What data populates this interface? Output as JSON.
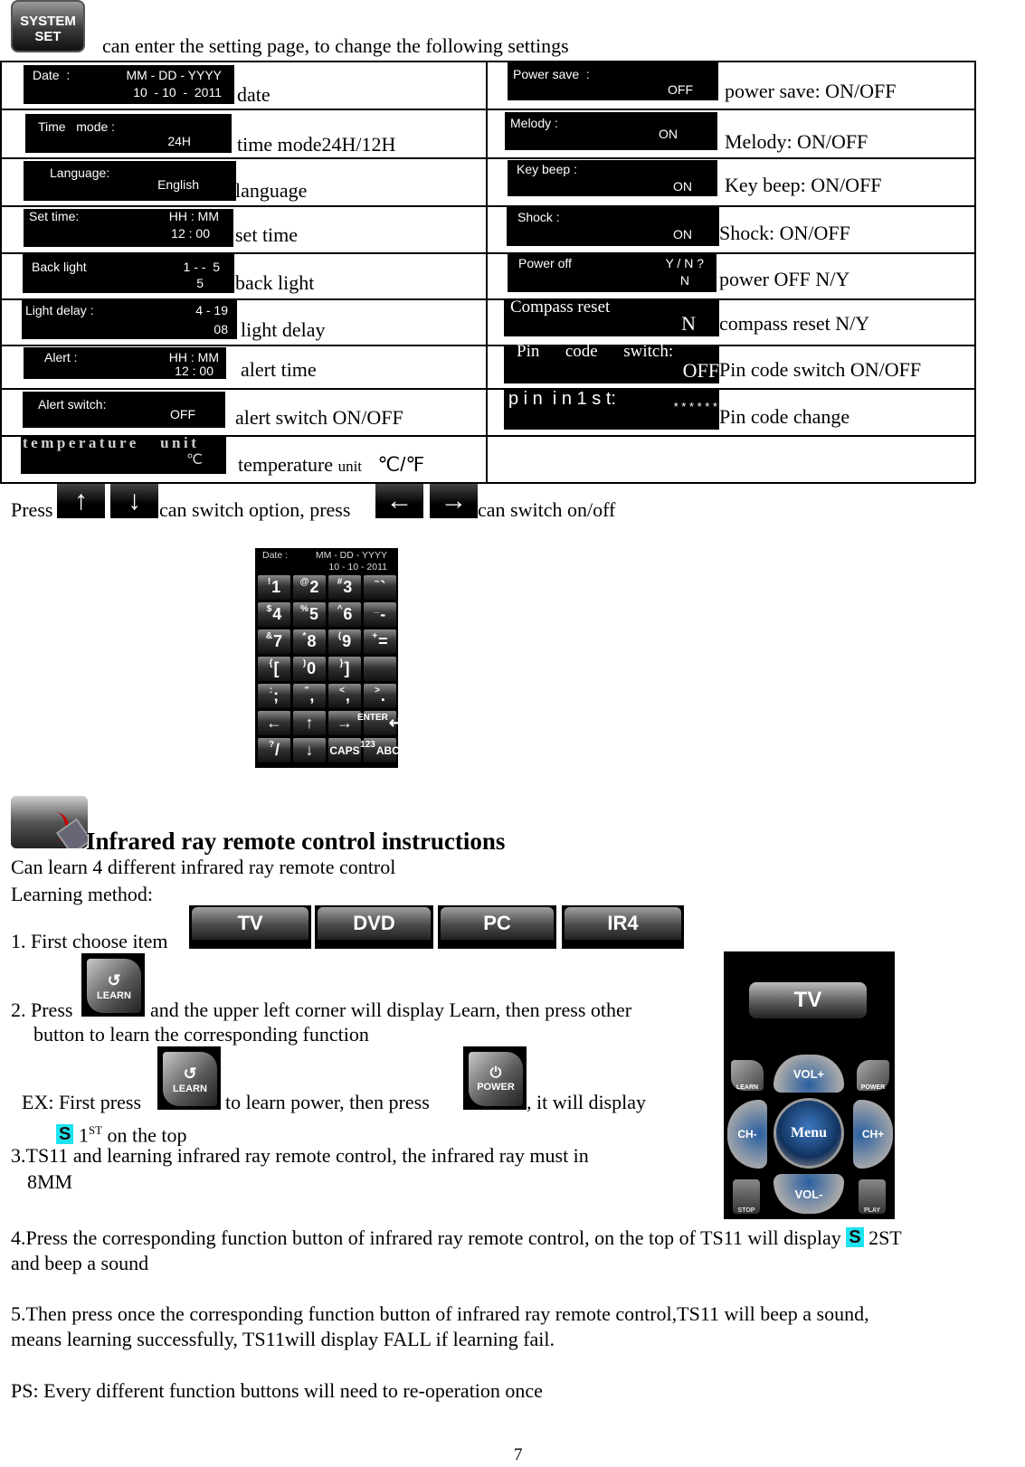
{
  "intro": {
    "system_set_icon": [
      "SYSTEM",
      "SET"
    ],
    "text": "can enter the setting page, to change the following settings"
  },
  "settings_left": [
    {
      "screen_label": "Date  :",
      "screen_top": "MM - DD - YYYY",
      "screen_value": "10  - 10  -  2011",
      "caption": "date"
    },
    {
      "screen_label": "Time   mode :",
      "screen_top": "",
      "screen_value": "24H",
      "caption": "time mode24H/12H"
    },
    {
      "screen_label": "Language:",
      "screen_top": "",
      "screen_value": "English",
      "caption": "language"
    },
    {
      "screen_label": "Set time:",
      "screen_top": "HH : MM",
      "screen_value": "12 : 00",
      "caption": "set time"
    },
    {
      "screen_label": "Back light",
      "screen_top": "1 - -  5",
      "screen_value": "5",
      "caption": "back light"
    },
    {
      "screen_label": "Light delay :",
      "screen_top": "4 - 19",
      "screen_value": "08",
      "caption": "light delay"
    },
    {
      "screen_label": "Alert :",
      "screen_top": "HH : MM",
      "screen_value": "12 : 00",
      "caption": "alert time"
    },
    {
      "screen_label": "Alert switch:",
      "screen_top": "",
      "screen_value": "OFF",
      "caption": "alert switch ON/OFF"
    },
    {
      "screen_label": "temperature   unit",
      "screen_top": "",
      "screen_value": "℃",
      "caption": "temperature",
      "caption_small": "unit",
      "caption_symbol": "℃/℉"
    }
  ],
  "settings_right": [
    {
      "screen_label": "Power save  :",
      "screen_value": "OFF",
      "caption": "power save: ON/OFF"
    },
    {
      "screen_label": "Melody :",
      "screen_value": "ON",
      "caption": "Melody: ON/OFF"
    },
    {
      "screen_label": "Key beep :",
      "screen_value": "ON",
      "caption": "Key beep: ON/OFF"
    },
    {
      "screen_label": "Shock :",
      "screen_value": "ON",
      "caption": "Shock: ON/OFF"
    },
    {
      "screen_label": "Power off",
      "screen_top": "Y / N ?",
      "screen_value": "N",
      "caption": "power OFF N/Y"
    },
    {
      "screen_label": "Compass reset",
      "screen_value": "N",
      "caption": "compass reset N/Y"
    },
    {
      "screen_label": "Pin      code      switch:",
      "screen_value": "OFF",
      "caption": "Pin code switch ON/OFF"
    },
    {
      "screen_label": "p i n  i n 1 s t:",
      "screen_value": "* * * * * *",
      "caption": "Pin code change"
    }
  ],
  "nav_line": {
    "press": "Press",
    "switch_option": "can switch option, press",
    "switch_onoff": "can switch on/off",
    "arrows": [
      "↑",
      "↓",
      "←",
      "→"
    ]
  },
  "keyboard": {
    "header_label": "Date  :",
    "header_top": "MM - DD - YYYY",
    "header_value": "10  -  10  -  2011",
    "keys": [
      {
        "sub": "!",
        "main": "1"
      },
      {
        "sub": "@",
        "main": "2"
      },
      {
        "sub": "#",
        "main": "3"
      },
      {
        "sub": "~",
        "main": "`"
      },
      {
        "sub": "$",
        "main": "4"
      },
      {
        "sub": "%",
        "main": "5"
      },
      {
        "sub": "^",
        "main": "6"
      },
      {
        "sub": "_",
        "main": "-"
      },
      {
        "sub": "&",
        "main": "7"
      },
      {
        "sub": "*",
        "main": "8"
      },
      {
        "sub": "(",
        "main": "9"
      },
      {
        "sub": "+",
        "main": "="
      },
      {
        "sub": "{",
        "main": "["
      },
      {
        "sub": ")",
        "main": "0"
      },
      {
        "sub": "}",
        "main": "]"
      },
      {
        "sub": "",
        "main": ""
      },
      {
        "sub": ":",
        "main": ";"
      },
      {
        "sub": "\"",
        "main": ","
      },
      {
        "sub": "<",
        "main": ","
      },
      {
        "sub": ">",
        "main": "."
      },
      {
        "sub": "",
        "main": "←"
      },
      {
        "sub": "",
        "main": "↑"
      },
      {
        "sub": "",
        "main": "→"
      },
      {
        "sub": "ENTER",
        "main": "↵"
      },
      {
        "sub": "?",
        "main": "/"
      },
      {
        "sub": "",
        "main": "↓"
      },
      {
        "sub": "",
        "main": "CAPS"
      },
      {
        "sub": "123",
        "main": "ABC"
      }
    ]
  },
  "ir_section": {
    "title": "Infrared ray remote control instructions",
    "line1": "Can learn 4 different infrared ray remote control",
    "line2": "Learning method:",
    "step1": "1. First choose item",
    "tabs": [
      "TV",
      "DVD",
      "PC",
      "IR4"
    ],
    "step2a": "2. Press",
    "step2b": "and the upper left corner will display Learn, then press other",
    "step2c": "button to learn the corresponding function",
    "learn_label": "LEARN",
    "power_label": "POWER",
    "ex_a": "EX: First press",
    "ex_b": "to learn power, then press",
    "ex_c": ", it will display",
    "s_badge": "S",
    "ex_d_num": "1",
    "ex_d_sup": "ST",
    "ex_d_rest": "on the top",
    "step3a": "3.TS11 and learning infrared ray remote control, the infrared ray must in",
    "step3b": "8MM",
    "step4a": "4.Press the corresponding function button of infrared ray remote control, on the top of TS11 will display",
    "step4_badge_after": "2ST",
    "step4b": "and beep a sound",
    "step5a": "5.Then press once the corresponding function button of infrared ray remote control,TS11 will beep a sound,",
    "step5b": "means learning successfully, TS11will display FALL if learning fail.",
    "ps": "PS: Every different function buttons will need to re-operation once"
  },
  "remote": {
    "tab": "TV",
    "learn": "LEARN",
    "power": "POWER",
    "vol_up": "VOL+",
    "vol_down": "VOL-",
    "ch_down": "CH-",
    "ch_up": "CH+",
    "menu": "Menu",
    "stop": "STOP",
    "play": "PLAY"
  },
  "page_number": "7"
}
